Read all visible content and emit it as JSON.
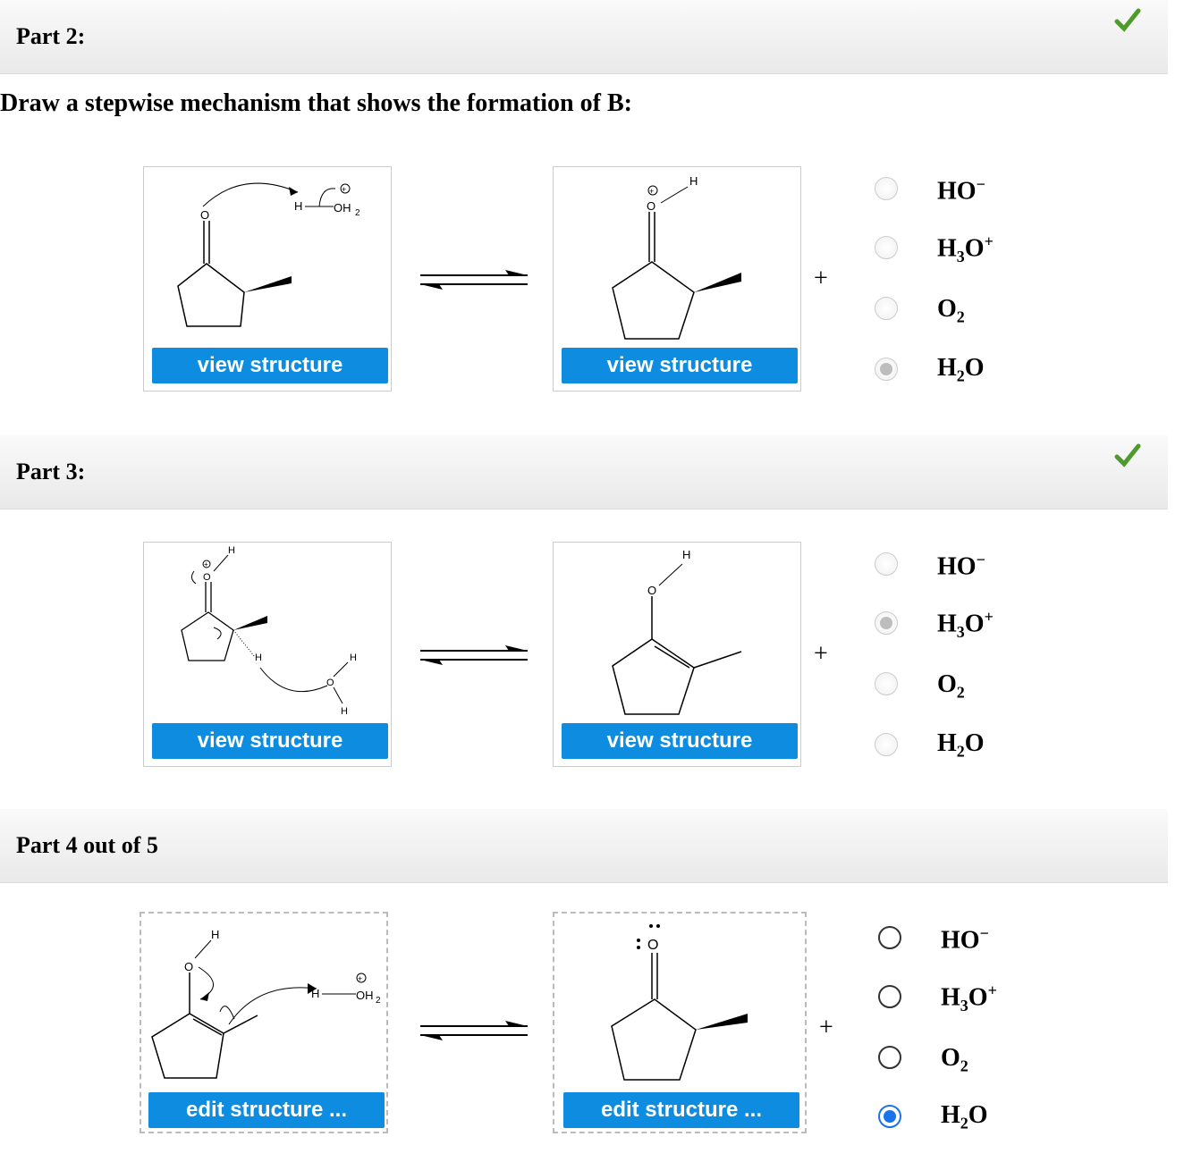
{
  "question": "Draw a stepwise mechanism that shows the formation of B:",
  "parts": [
    {
      "title": "Part 2:",
      "left_button": "view structure",
      "right_button": "view structure",
      "plus": "+",
      "options": [
        "HO",
        "H3O+",
        "O2",
        "H2O"
      ],
      "selected": 3
    },
    {
      "title": "Part 3:",
      "left_button": "view structure",
      "right_button": "view structure",
      "plus": "+",
      "options": [
        "HO",
        "H3O+",
        "O2",
        "H2O"
      ],
      "selected": 1
    },
    {
      "title": "Part 4 out of 5",
      "left_button": "edit structure ...",
      "right_button": "edit structure ...",
      "plus": "+",
      "options": [
        "HO",
        "H3O+",
        "O2",
        "H2O"
      ],
      "selected": 3
    }
  ],
  "colors": {
    "check": "#4e9a2a",
    "button": "#0d8ce0",
    "selected_radio": "#1a73e8"
  },
  "icons": [
    "checkmark-icon",
    "equilibrium-arrows-icon"
  ]
}
